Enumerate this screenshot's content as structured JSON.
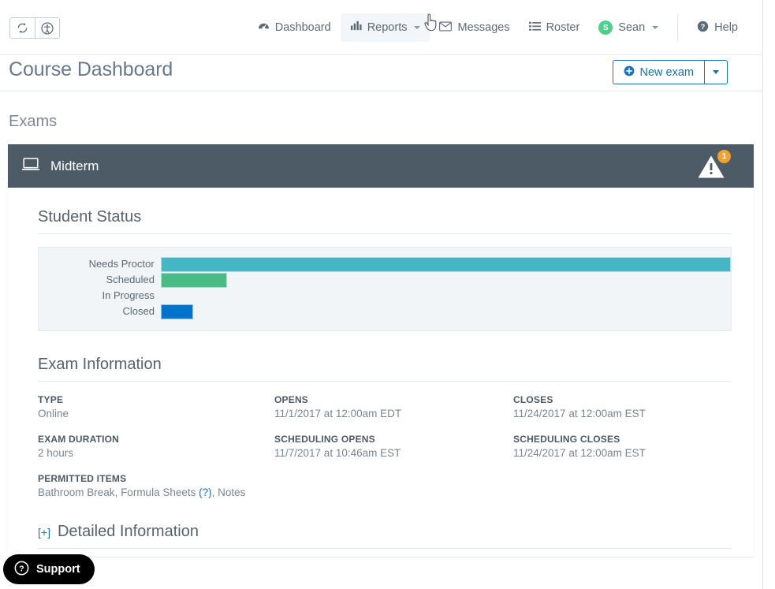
{
  "topbar": {
    "tools": [
      {
        "name": "refresh-icon",
        "label": "Refresh"
      },
      {
        "name": "accessibility-icon",
        "label": "Accessibility"
      }
    ],
    "nav": [
      {
        "label": "Dashboard",
        "icon": "dashboard-icon",
        "active": false,
        "caret": false
      },
      {
        "label": "Reports",
        "icon": "bar-chart-icon",
        "active": true,
        "caret": true
      },
      {
        "label": "Messages",
        "icon": "envelope-icon",
        "active": false,
        "caret": false
      },
      {
        "label": "Roster",
        "icon": "list-icon",
        "active": false,
        "caret": false
      }
    ],
    "user": {
      "initial": "S",
      "name": "Sean",
      "avatar_color": "#4ed08c"
    },
    "help": {
      "label": "Help",
      "icon": "help-circle-icon"
    }
  },
  "header": {
    "title": "Course Dashboard",
    "new_exam_label": "New exam",
    "new_exam_icon": "plus-circle-icon",
    "accent_color": "#1272c4"
  },
  "exams_section": {
    "label": "Exams"
  },
  "exam": {
    "name": "Midterm",
    "icon": "laptop-icon",
    "header_color": "#4c5b66",
    "warning": {
      "icon": "warning-triangle-icon",
      "count": "1",
      "badge_color": "#f0a22e"
    },
    "student_status_title": "Student Status",
    "exam_information_title": "Exam Information",
    "info": [
      {
        "key": "TYPE",
        "value": "Online"
      },
      {
        "key": "OPENS",
        "value": "11/1/2017 at 12:00am EDT"
      },
      {
        "key": "CLOSES",
        "value": "11/24/2017 at 12:00am EST"
      },
      {
        "key": "EXAM DURATION",
        "value": "2 hours"
      },
      {
        "key": "SCHEDULING OPENS",
        "value": "11/7/2017 at 10:46am EST"
      },
      {
        "key": "SCHEDULING CLOSES",
        "value": "11/24/2017 at 12:00am EST"
      }
    ],
    "permitted": {
      "key": "PERMITTED ITEMS",
      "part1": "Bathroom Break,",
      "part2": "Formula Sheets",
      "help_link": "(?)",
      "part3": ", Notes"
    },
    "detailed": {
      "toggle": "[+]",
      "title": "Detailed Information"
    }
  },
  "support": {
    "label": "Support",
    "icon": "question-circle-icon"
  },
  "chart_data": {
    "type": "bar",
    "orientation": "horizontal",
    "title": "Student Status",
    "categories": [
      "Needs Proctor",
      "Scheduled",
      "In Progress",
      "Closed"
    ],
    "values": [
      100,
      11.6,
      0,
      5.7
    ],
    "unit": "percent-of-track",
    "colors": [
      "#45b6c6",
      "#4abb86",
      "#f1f5f8",
      "#0073ce"
    ],
    "xlabel": "",
    "ylabel": "",
    "xlim": [
      0,
      100
    ],
    "grid": false,
    "legend": false,
    "background": "#f1f5f8"
  }
}
